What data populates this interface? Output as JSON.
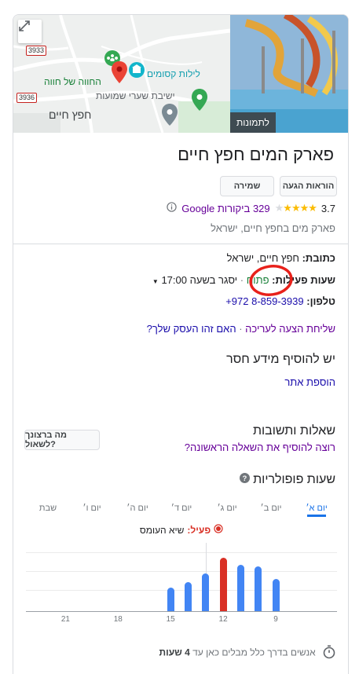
{
  "map": {
    "road_badges": [
      "3933",
      "3936"
    ],
    "labels": {
      "farm": "החווה של חווה",
      "magic_nights": "לילות קסומים",
      "yeshiva": "ישיבת שערי שמועות",
      "town": "חפץ חיים"
    },
    "expand_icon": "expand-arrows-icon"
  },
  "photo": {
    "label": "לתמונות"
  },
  "place": {
    "title": "פארק המים חפץ חיים",
    "actions": {
      "directions": "הוראות הגעה",
      "save": "שמירה"
    },
    "rating": "3.7",
    "reviews": "329 ביקורות Google",
    "category": "פארק מים בחפץ חיים, ישראל"
  },
  "info": {
    "address_label": "כתובת:",
    "address_value": "חפץ חיים, ישראל",
    "hours_label": "שעות פעילות:",
    "hours_status": "פתוח",
    "hours_detail": "יסגר בשעה 17:00",
    "phone_label": "טלפון:",
    "phone_value": "+972 8-859-3939",
    "suggest_edit": "שליחת הצעה לעריכה",
    "own_business": "האם זהו העסק שלך?"
  },
  "missing": {
    "heading": "יש להוסיף מידע חסר",
    "add_website": "הוספת אתר"
  },
  "qa": {
    "heading": "שאלות ותשובות",
    "prompt": "רוצה להוסיף את השאלה הראשונה?",
    "ask_button": "מה ברצונך לשאול?"
  },
  "popular": {
    "heading": "שעות פופולריות",
    "help_icon": "help-icon",
    "days": [
      "יום א׳",
      "יום ב׳",
      "יום ג׳",
      "יום ד׳",
      "יום ה׳",
      "יום ו׳",
      "שבת"
    ],
    "selected_day": "יום א׳",
    "live_label": "פעיל:",
    "live_status": "שיא העומס",
    "dwell_prefix": "אנשים בדרך כלל מבלים כאן עד",
    "dwell_value": "4 שעות",
    "live_color": "#d93025",
    "bar_color": "#4285f4"
  },
  "chart_data": {
    "type": "bar",
    "x_ticks": [
      "9",
      "12",
      "15",
      "18",
      "21"
    ],
    "hours": [
      9,
      10,
      11,
      12,
      13,
      14,
      15
    ],
    "values": [
      47,
      65,
      68,
      78,
      55,
      42,
      34
    ],
    "live_hour": 12,
    "ylim": [
      0,
      100
    ]
  }
}
